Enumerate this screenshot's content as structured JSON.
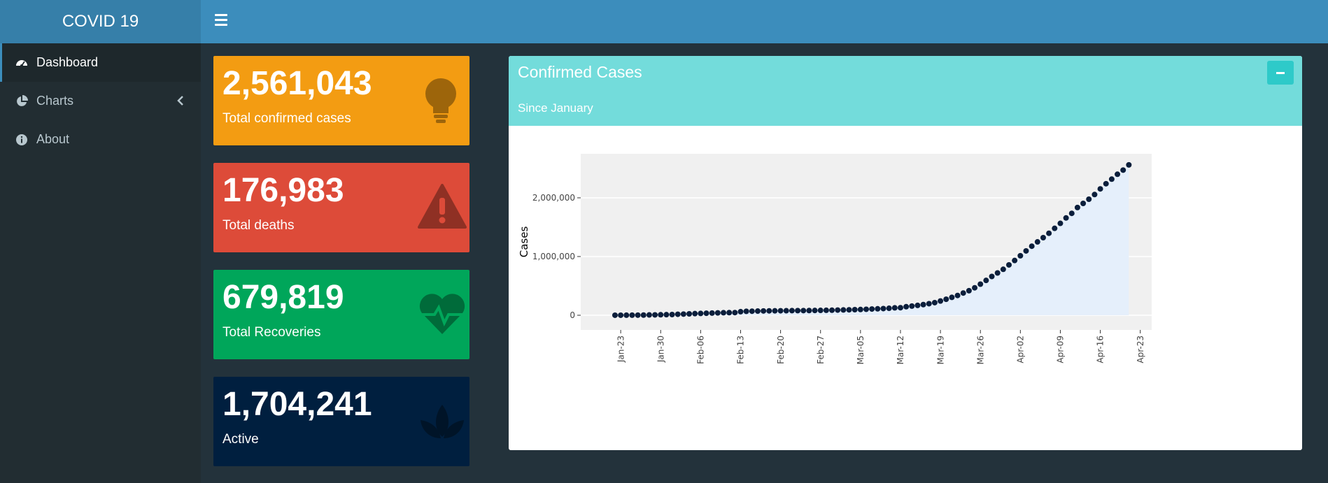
{
  "app": {
    "title": "COVID 19"
  },
  "sidebar": {
    "items": [
      {
        "label": "Dashboard",
        "icon": "dashboard-icon"
      },
      {
        "label": "Charts",
        "icon": "pie-chart-icon"
      },
      {
        "label": "About",
        "icon": "info-icon"
      }
    ]
  },
  "stats": [
    {
      "value": "2,561,043",
      "label": "Total confirmed cases",
      "color": "#f39c12",
      "icon": "lightbulb-icon"
    },
    {
      "value": "176,983",
      "label": "Total deaths",
      "color": "#dd4b39",
      "icon": "warning-icon"
    },
    {
      "value": "679,819",
      "label": "Total Recoveries",
      "color": "#00a65a",
      "icon": "heartbeat-icon"
    },
    {
      "value": "1,704,241",
      "label": "Active",
      "color": "#001f3f",
      "icon": "leaf-icon"
    }
  ],
  "panel": {
    "title": "Confirmed Cases",
    "subtitle": "Since January"
  },
  "chart_data": {
    "type": "scatter",
    "ylabel": "Cases",
    "xlabel": "",
    "ylim": [
      -250000,
      2750000
    ],
    "xlim": [
      "2020-01-16",
      "2020-04-25"
    ],
    "x_ticks": [
      "Jan-23",
      "Jan-30",
      "Feb-06",
      "Feb-13",
      "Feb-20",
      "Feb-27",
      "Mar-05",
      "Mar-12",
      "Mar-19",
      "Mar-26",
      "Apr-02",
      "Apr-09",
      "Apr-16",
      "Apr-23"
    ],
    "y_ticks": [
      "0",
      "1,000,000",
      "2,000,000"
    ],
    "y_tick_values": [
      0,
      1000000,
      2000000
    ],
    "fill_to_zero": true,
    "series": [
      {
        "x": [
          "2020-01-22",
          "2020-01-23",
          "2020-01-24",
          "2020-01-25",
          "2020-01-26",
          "2020-01-27",
          "2020-01-28",
          "2020-01-29",
          "2020-01-30",
          "2020-01-31",
          "2020-02-01",
          "2020-02-02",
          "2020-02-03",
          "2020-02-04",
          "2020-02-05",
          "2020-02-06",
          "2020-02-07",
          "2020-02-08",
          "2020-02-09",
          "2020-02-10",
          "2020-02-11",
          "2020-02-12",
          "2020-02-13",
          "2020-02-14",
          "2020-02-15",
          "2020-02-16",
          "2020-02-17",
          "2020-02-18",
          "2020-02-19",
          "2020-02-20",
          "2020-02-21",
          "2020-02-22",
          "2020-02-23",
          "2020-02-24",
          "2020-02-25",
          "2020-02-26",
          "2020-02-27",
          "2020-02-28",
          "2020-02-29",
          "2020-03-01",
          "2020-03-02",
          "2020-03-03",
          "2020-03-04",
          "2020-03-05",
          "2020-03-06",
          "2020-03-07",
          "2020-03-08",
          "2020-03-09",
          "2020-03-10",
          "2020-03-11",
          "2020-03-12",
          "2020-03-13",
          "2020-03-14",
          "2020-03-15",
          "2020-03-16",
          "2020-03-17",
          "2020-03-18",
          "2020-03-19",
          "2020-03-20",
          "2020-03-21",
          "2020-03-22",
          "2020-03-23",
          "2020-03-24",
          "2020-03-25",
          "2020-03-26",
          "2020-03-27",
          "2020-03-28",
          "2020-03-29",
          "2020-03-30",
          "2020-03-31",
          "2020-04-01",
          "2020-04-02",
          "2020-04-03",
          "2020-04-04",
          "2020-04-05",
          "2020-04-06",
          "2020-04-07",
          "2020-04-08",
          "2020-04-09",
          "2020-04-10",
          "2020-04-11",
          "2020-04-12",
          "2020-04-13",
          "2020-04-14",
          "2020-04-15",
          "2020-04-16",
          "2020-04-17",
          "2020-04-18",
          "2020-04-19",
          "2020-04-20",
          "2020-04-21"
        ],
        "y": [
          555,
          654,
          941,
          1434,
          2118,
          2927,
          5578,
          6166,
          8234,
          9927,
          12038,
          16787,
          19881,
          23892,
          27635,
          30794,
          34391,
          37120,
          40150,
          42762,
          44802,
          45221,
          60368,
          66885,
          69030,
          71224,
          73258,
          75136,
          75639,
          76197,
          76819,
          78572,
          78958,
          79561,
          80406,
          81388,
          82746,
          84112,
          86011,
          88369,
          90306,
          92840,
          95120,
          97886,
          101801,
          105847,
          109821,
          113590,
          118620,
          125875,
          128352,
          145205,
          156101,
          167454,
          181574,
          197102,
          214821,
          242570,
          272208,
          304507,
          336953,
          378235,
          418045,
          467653,
          529591,
          593291,
          660706,
          720117,
          782365,
          857487,
          932605,
          1013466,
          1095917,
          1176060,
          1249754,
          1321481,
          1396476,
          1480202,
          1565278,
          1657526,
          1735650,
          1834721,
          1904838,
          1976191,
          2056054,
          2152437,
          2240190,
          2317759,
          2401378,
          2472259,
          2561043
        ]
      }
    ]
  }
}
